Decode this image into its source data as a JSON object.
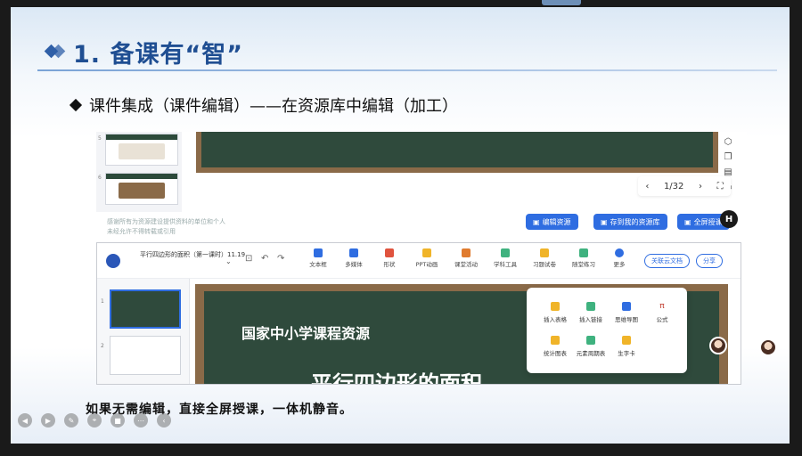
{
  "slide": {
    "title": "1. 备课有“智”",
    "bullet": "课件集成（课件编辑）——在资源库中编辑（加工）",
    "footer": "如果无需编辑，直接全屏授课，一体机静音。"
  },
  "viewer": {
    "thumb_numbers": [
      "5",
      "6"
    ],
    "pager": {
      "current": "1/32"
    },
    "notice_lines": [
      "感谢所有为资源建设提供资料的单位和个人",
      "未经允许不得转载或引用"
    ],
    "buttons": {
      "edit": "编辑资源",
      "save": "存到我的资源库",
      "fullscreen": "全屏授课"
    },
    "badge": "H"
  },
  "editor": {
    "doc_title": "平行四边形的面积（第一课时）11.19",
    "toolbar": [
      {
        "label": "文本框",
        "icon": "textbox-icon",
        "color": "#2f6de1"
      },
      {
        "label": "多媒体",
        "icon": "media-icon",
        "color": "#2f6de1"
      },
      {
        "label": "形状",
        "icon": "shape-icon",
        "color": "#e0533e"
      },
      {
        "label": "PPT动画",
        "icon": "animation-icon",
        "color": "#f0b429"
      },
      {
        "label": "课堂活动",
        "icon": "activity-icon",
        "color": "#e07b2e"
      },
      {
        "label": "学科工具",
        "icon": "subject-tool-icon",
        "color": "#3fb27f"
      },
      {
        "label": "习题试卷",
        "icon": "exercise-icon",
        "color": "#f0b429"
      },
      {
        "label": "随堂练习",
        "icon": "practice-icon",
        "color": "#3fb27f"
      },
      {
        "label": "更多",
        "icon": "more-icon",
        "color": "#2f6de1"
      }
    ],
    "related_doc": "关联云文档",
    "share": "分享",
    "slide_numbers": [
      "1",
      "2"
    ],
    "canvas_text": "国家中小学课程资源",
    "canvas_big": "平行四边形的面积",
    "more_menu": [
      {
        "label": "插入表格",
        "icon": "table-icon",
        "color": "#f0b429"
      },
      {
        "label": "插入链接",
        "icon": "link-icon",
        "color": "#3fb27f"
      },
      {
        "label": "思维导图",
        "icon": "mindmap-icon",
        "color": "#2f6de1"
      },
      {
        "label": "公式",
        "icon": "formula-icon",
        "color": "#e0533e",
        "glyph": "π"
      },
      {
        "label": "统计图表",
        "icon": "chart-icon",
        "color": "#f0b429"
      },
      {
        "label": "元素周期表",
        "icon": "periodic-table-icon",
        "color": "#3fb27f"
      },
      {
        "label": "生字卡",
        "icon": "word-card-icon",
        "color": "#f0b429"
      }
    ]
  },
  "bottom_bar": [
    "prev-icon",
    "next-icon",
    "pen-icon",
    "pointer-icon",
    "camera-icon",
    "more-dots-icon",
    "collapse-icon"
  ]
}
